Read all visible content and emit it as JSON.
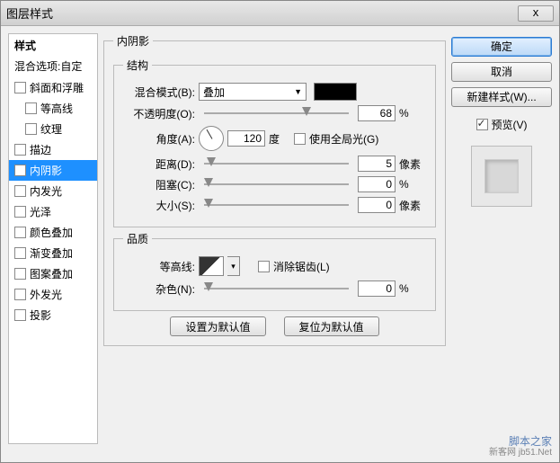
{
  "window": {
    "title": "图层样式",
    "close": "x"
  },
  "sidebar": {
    "header": "样式",
    "blending": "混合选项:自定",
    "items": [
      {
        "label": "斜面和浮雕",
        "indent": false,
        "checked": false
      },
      {
        "label": "等高线",
        "indent": true,
        "checked": false
      },
      {
        "label": "纹理",
        "indent": true,
        "checked": false
      },
      {
        "label": "描边",
        "indent": false,
        "checked": false
      },
      {
        "label": "内阴影",
        "indent": false,
        "checked": true,
        "selected": true
      },
      {
        "label": "内发光",
        "indent": false,
        "checked": false
      },
      {
        "label": "光泽",
        "indent": false,
        "checked": false
      },
      {
        "label": "颜色叠加",
        "indent": false,
        "checked": false
      },
      {
        "label": "渐变叠加",
        "indent": false,
        "checked": false
      },
      {
        "label": "图案叠加",
        "indent": false,
        "checked": false
      },
      {
        "label": "外发光",
        "indent": false,
        "checked": false
      },
      {
        "label": "投影",
        "indent": false,
        "checked": false
      }
    ]
  },
  "panel": {
    "title": "内阴影",
    "structure": {
      "legend": "结构",
      "blendMode": {
        "label": "混合模式(B):",
        "value": "叠加",
        "color": "#000000"
      },
      "opacity": {
        "label": "不透明度(O):",
        "value": "68",
        "unit": "%",
        "pos": 68
      },
      "angle": {
        "label": "角度(A):",
        "value": "120",
        "unit": "度",
        "globalLabel": "使用全局光(G)",
        "globalChecked": false
      },
      "distance": {
        "label": "距离(D):",
        "value": "5",
        "unit": "像素",
        "pos": 2
      },
      "choke": {
        "label": "阻塞(C):",
        "value": "0",
        "unit": "%",
        "pos": 0
      },
      "size": {
        "label": "大小(S):",
        "value": "0",
        "unit": "像素",
        "pos": 0
      }
    },
    "quality": {
      "legend": "品质",
      "contour": {
        "label": "等高线:",
        "antialias": "消除锯齿(L)",
        "aaChecked": false
      },
      "noise": {
        "label": "杂色(N):",
        "value": "0",
        "unit": "%",
        "pos": 0
      }
    },
    "buttons": {
      "setDefault": "设置为默认值",
      "resetDefault": "复位为默认值"
    }
  },
  "right": {
    "ok": "确定",
    "cancel": "取消",
    "newStyle": "新建样式(W)...",
    "previewLabel": "预览(V)",
    "previewChecked": true
  },
  "watermark": {
    "line1": "脚本之家",
    "line2": "新客网  jb51.Net"
  }
}
